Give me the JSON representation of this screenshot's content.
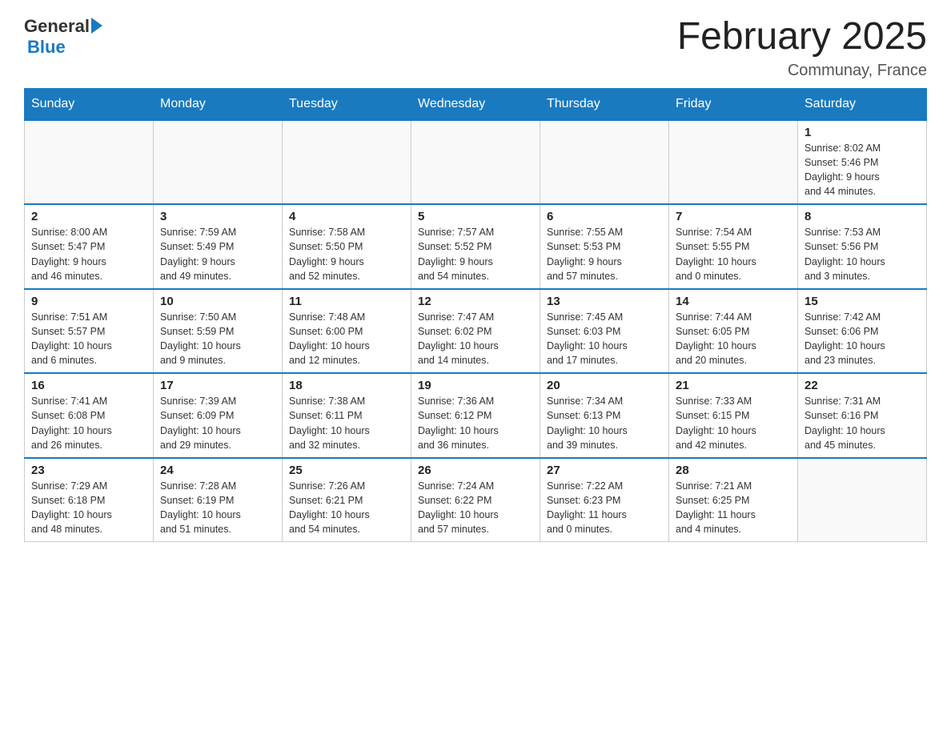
{
  "header": {
    "logo_general": "General",
    "logo_blue": "Blue",
    "month_title": "February 2025",
    "location": "Communay, France"
  },
  "weekdays": [
    "Sunday",
    "Monday",
    "Tuesday",
    "Wednesday",
    "Thursday",
    "Friday",
    "Saturday"
  ],
  "weeks": [
    [
      {
        "day": "",
        "info": ""
      },
      {
        "day": "",
        "info": ""
      },
      {
        "day": "",
        "info": ""
      },
      {
        "day": "",
        "info": ""
      },
      {
        "day": "",
        "info": ""
      },
      {
        "day": "",
        "info": ""
      },
      {
        "day": "1",
        "info": "Sunrise: 8:02 AM\nSunset: 5:46 PM\nDaylight: 9 hours\nand 44 minutes."
      }
    ],
    [
      {
        "day": "2",
        "info": "Sunrise: 8:00 AM\nSunset: 5:47 PM\nDaylight: 9 hours\nand 46 minutes."
      },
      {
        "day": "3",
        "info": "Sunrise: 7:59 AM\nSunset: 5:49 PM\nDaylight: 9 hours\nand 49 minutes."
      },
      {
        "day": "4",
        "info": "Sunrise: 7:58 AM\nSunset: 5:50 PM\nDaylight: 9 hours\nand 52 minutes."
      },
      {
        "day": "5",
        "info": "Sunrise: 7:57 AM\nSunset: 5:52 PM\nDaylight: 9 hours\nand 54 minutes."
      },
      {
        "day": "6",
        "info": "Sunrise: 7:55 AM\nSunset: 5:53 PM\nDaylight: 9 hours\nand 57 minutes."
      },
      {
        "day": "7",
        "info": "Sunrise: 7:54 AM\nSunset: 5:55 PM\nDaylight: 10 hours\nand 0 minutes."
      },
      {
        "day": "8",
        "info": "Sunrise: 7:53 AM\nSunset: 5:56 PM\nDaylight: 10 hours\nand 3 minutes."
      }
    ],
    [
      {
        "day": "9",
        "info": "Sunrise: 7:51 AM\nSunset: 5:57 PM\nDaylight: 10 hours\nand 6 minutes."
      },
      {
        "day": "10",
        "info": "Sunrise: 7:50 AM\nSunset: 5:59 PM\nDaylight: 10 hours\nand 9 minutes."
      },
      {
        "day": "11",
        "info": "Sunrise: 7:48 AM\nSunset: 6:00 PM\nDaylight: 10 hours\nand 12 minutes."
      },
      {
        "day": "12",
        "info": "Sunrise: 7:47 AM\nSunset: 6:02 PM\nDaylight: 10 hours\nand 14 minutes."
      },
      {
        "day": "13",
        "info": "Sunrise: 7:45 AM\nSunset: 6:03 PM\nDaylight: 10 hours\nand 17 minutes."
      },
      {
        "day": "14",
        "info": "Sunrise: 7:44 AM\nSunset: 6:05 PM\nDaylight: 10 hours\nand 20 minutes."
      },
      {
        "day": "15",
        "info": "Sunrise: 7:42 AM\nSunset: 6:06 PM\nDaylight: 10 hours\nand 23 minutes."
      }
    ],
    [
      {
        "day": "16",
        "info": "Sunrise: 7:41 AM\nSunset: 6:08 PM\nDaylight: 10 hours\nand 26 minutes."
      },
      {
        "day": "17",
        "info": "Sunrise: 7:39 AM\nSunset: 6:09 PM\nDaylight: 10 hours\nand 29 minutes."
      },
      {
        "day": "18",
        "info": "Sunrise: 7:38 AM\nSunset: 6:11 PM\nDaylight: 10 hours\nand 32 minutes."
      },
      {
        "day": "19",
        "info": "Sunrise: 7:36 AM\nSunset: 6:12 PM\nDaylight: 10 hours\nand 36 minutes."
      },
      {
        "day": "20",
        "info": "Sunrise: 7:34 AM\nSunset: 6:13 PM\nDaylight: 10 hours\nand 39 minutes."
      },
      {
        "day": "21",
        "info": "Sunrise: 7:33 AM\nSunset: 6:15 PM\nDaylight: 10 hours\nand 42 minutes."
      },
      {
        "day": "22",
        "info": "Sunrise: 7:31 AM\nSunset: 6:16 PM\nDaylight: 10 hours\nand 45 minutes."
      }
    ],
    [
      {
        "day": "23",
        "info": "Sunrise: 7:29 AM\nSunset: 6:18 PM\nDaylight: 10 hours\nand 48 minutes."
      },
      {
        "day": "24",
        "info": "Sunrise: 7:28 AM\nSunset: 6:19 PM\nDaylight: 10 hours\nand 51 minutes."
      },
      {
        "day": "25",
        "info": "Sunrise: 7:26 AM\nSunset: 6:21 PM\nDaylight: 10 hours\nand 54 minutes."
      },
      {
        "day": "26",
        "info": "Sunrise: 7:24 AM\nSunset: 6:22 PM\nDaylight: 10 hours\nand 57 minutes."
      },
      {
        "day": "27",
        "info": "Sunrise: 7:22 AM\nSunset: 6:23 PM\nDaylight: 11 hours\nand 0 minutes."
      },
      {
        "day": "28",
        "info": "Sunrise: 7:21 AM\nSunset: 6:25 PM\nDaylight: 11 hours\nand 4 minutes."
      },
      {
        "day": "",
        "info": ""
      }
    ]
  ]
}
